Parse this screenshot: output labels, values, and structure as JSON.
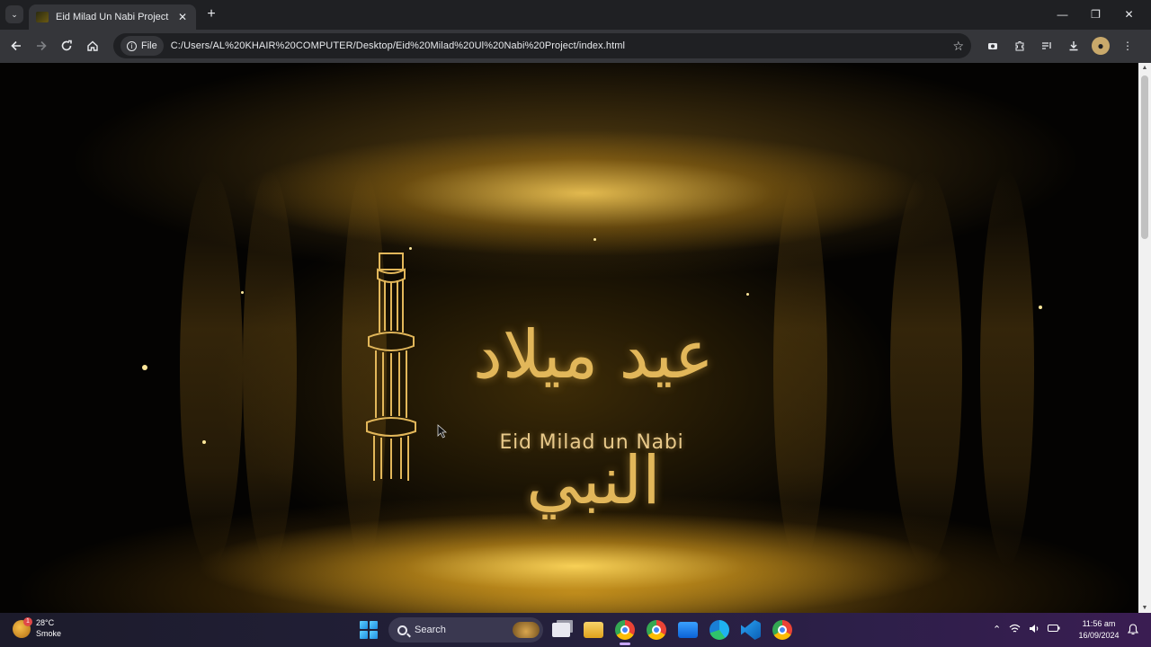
{
  "browser": {
    "tab_title": "Eid Milad Un Nabi Project",
    "new_tab": "+",
    "close_tab": "✕",
    "chip_label": "File",
    "url": "C:/Users/AL%20KHAIR%20COMPUTER/Desktop/Eid%20Milad%20Ul%20Nabi%20Project/index.html",
    "window_controls": [
      "—",
      "❐",
      "✕"
    ]
  },
  "hero": {
    "arabic_title": "عيد ميلاد النبي",
    "english_title": "Eid Milad un Nabi",
    "accent_gold": "#e2b75a"
  },
  "taskbar": {
    "weather_temp": "28°C",
    "weather_desc": "Smoke",
    "weather_badge": "1",
    "search_label": "Search",
    "time": "11:56 am",
    "date": "16/09/2024"
  }
}
